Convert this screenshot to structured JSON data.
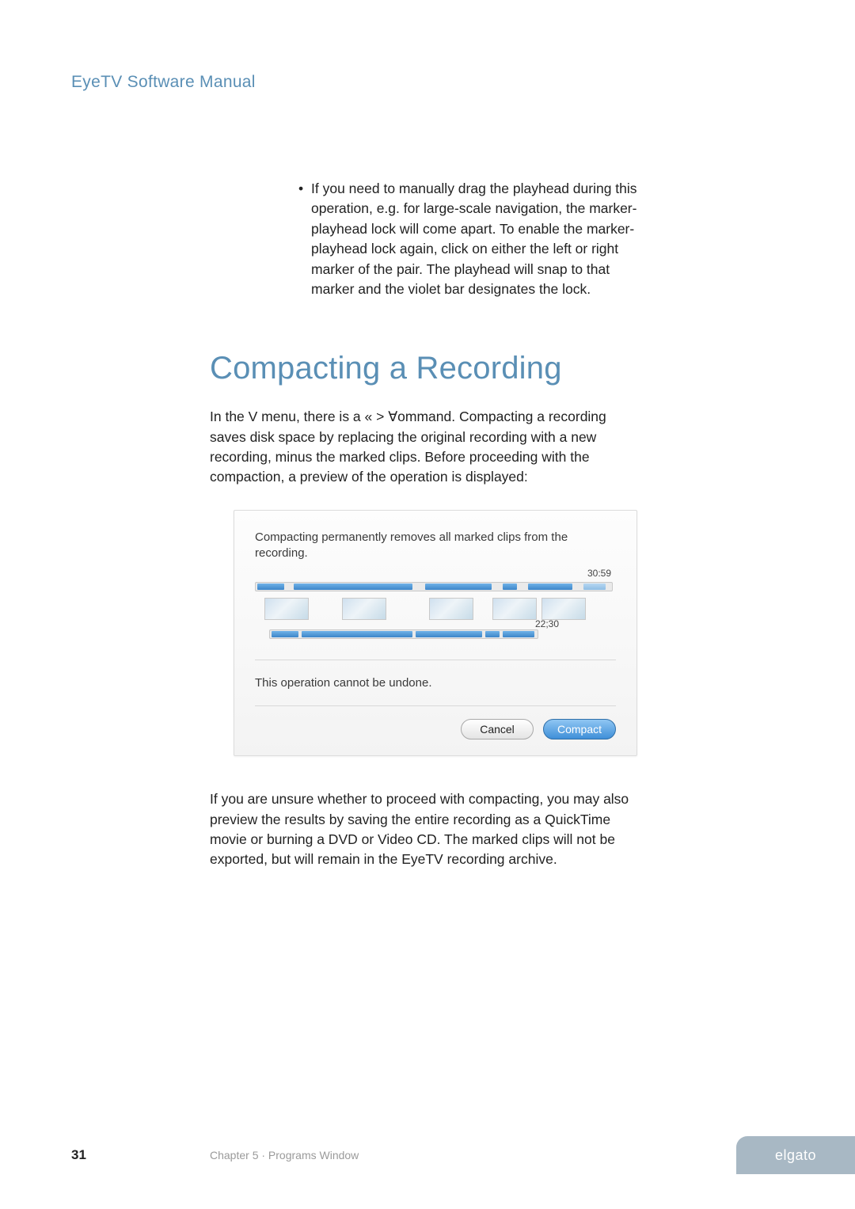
{
  "header": {
    "manual_title": "EyeTV Software Manual"
  },
  "bullet": {
    "text": "If you need to manually drag the playhead during this operation, e.g. for large-scale navigation, the marker-playhead lock will come apart. To enable the marker-playhead lock again, click on either the left or right marker of the pair. The playhead will snap to that marker and the violet bar designates the lock."
  },
  "section": {
    "heading": "Compacting a Recording"
  },
  "para1": "In the  V   menu, there is a     « > ∀ommand.  Compacting a recording saves disk space by replacing the original recording with a new recording, minus the marked clips. Before proceeding with the compaction, a preview of the operation is displayed:",
  "dialog": {
    "title": "Compacting permanently removes all marked clips from the recording.",
    "time_total": "30:59",
    "time_compacted": "22;30",
    "warning": "This operation cannot be undone.",
    "cancel_label": "Cancel",
    "compact_label": "Compact"
  },
  "para2": "If you are unsure whether to proceed with compacting, you may also preview the results by saving the entire recording as a QuickTime movie or burning a DVD or Video CD. The marked clips will not be exported, but will remain in the EyeTV recording archive.",
  "footer": {
    "page": "31",
    "chapter": "Chapter 5 · Programs Window",
    "brand": "elgato"
  }
}
